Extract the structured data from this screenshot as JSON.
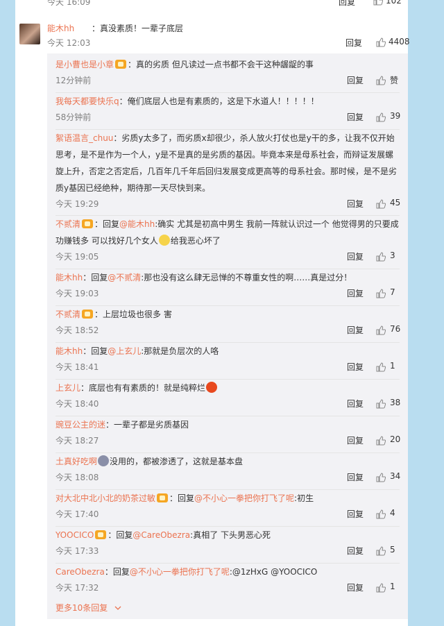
{
  "top_row": {
    "time": "今天 16:09",
    "reply": "回复",
    "likes": "102"
  },
  "main_comment": {
    "username": "能木hh",
    "text": "：真没素质！一辈子底层",
    "time": "今天 12:03",
    "reply": "回复",
    "likes": "4408"
  },
  "replies": [
    {
      "user": "是小曹也是小章",
      "badge": true,
      "text": "：真的劣质 但凡读过一点书都不会干这种龌龊的事",
      "time": "12分钟前",
      "reply": "回复",
      "likes": "赞"
    },
    {
      "user": "我每天都要快乐q",
      "badge": false,
      "text": "：俺们底层人也是有素质的，这是下水道人！！！！！",
      "time": "58分钟前",
      "reply": "回复",
      "likes": "39"
    },
    {
      "user": "絮语温言_chuu",
      "badge": false,
      "text": "：劣质y太多了，而劣质x却很少，杀人放火打仗也是y干的多，让我不仅开始思考，是不是作为一个人，y是不是真的是劣质的基因。毕竟本来是母系社会，而辩证发展螺旋上升，否定之否定后，几百年几千年后回归发展变成更高等的母系社会。那时候，是不是劣质y基因已经绝种，期待那一天尽快到来。",
      "time": "今天 19:29",
      "reply": "回复",
      "likes": "45"
    },
    {
      "user": "不贰清",
      "badge": true,
      "prefix": "：回复",
      "at": "@能木hh",
      "text": ":确实 尤其是初高中男生 我前一阵就认识过一个 他觉得男的只要成功赚钱多 可以找好几个女人",
      "text2": "给我恶心坏了",
      "time": "今天 19:05",
      "reply": "回复",
      "likes": "3"
    },
    {
      "user": "能木hh",
      "badge": false,
      "prefix": "：回复",
      "at": "@不贰清",
      "text": ":那也没有这么肆无忌惮的不尊重女性的啊……真是过分！",
      "time": "今天 19:03",
      "reply": "回复",
      "likes": "7"
    },
    {
      "user": "不贰清",
      "badge": true,
      "text": "：上层垃圾也很多 害",
      "time": "今天 18:52",
      "reply": "回复",
      "likes": "76"
    },
    {
      "user": "能木hh",
      "badge": false,
      "prefix": "：回复",
      "at": "@上玄儿",
      "text": ":那就是负层次的人咯",
      "time": "今天 18:41",
      "reply": "回复",
      "likes": "1"
    },
    {
      "user": "上玄儿",
      "badge": false,
      "text": "：底层也有有素质的！就是纯粹烂",
      "time": "今天 18:40",
      "reply": "回复",
      "likes": "38"
    },
    {
      "user": "豌豆公主的迷",
      "badge": false,
      "text": "：一辈子都是劣质基因",
      "time": "今天 18:27",
      "reply": "回复",
      "likes": "20"
    },
    {
      "user": "土真好吃啊",
      "badge": false,
      "text": "没用的，都被渗透了，这就是基本盘",
      "time": "今天 18:08",
      "reply": "回复",
      "likes": "34"
    },
    {
      "user": "对大北中北小北的奶茶过敏",
      "badge": true,
      "prefix": "：回复",
      "at": "@不小心一拳把你打飞了呢",
      "text": ":初生",
      "time": "今天 17:40",
      "reply": "回复",
      "likes": "4"
    },
    {
      "user": "YOOCICO",
      "badge": true,
      "prefix": "：回复",
      "at": "@CareObezra",
      "text": ":真相了 下头男恶心死",
      "time": "今天 17:33",
      "reply": "回复",
      "likes": "5"
    },
    {
      "user": "CareObezra",
      "badge": false,
      "prefix": "：回复",
      "at": "@不小心一拳把你打飞了呢",
      "text": ":@1zHxG @YOOCICO",
      "time": "今天 17:32",
      "reply": "回复",
      "likes": "1"
    }
  ],
  "more_replies": "更多10条回复",
  "icons": {
    "like": "thumbs-up-icon",
    "chevron": "chevron-down-icon"
  }
}
